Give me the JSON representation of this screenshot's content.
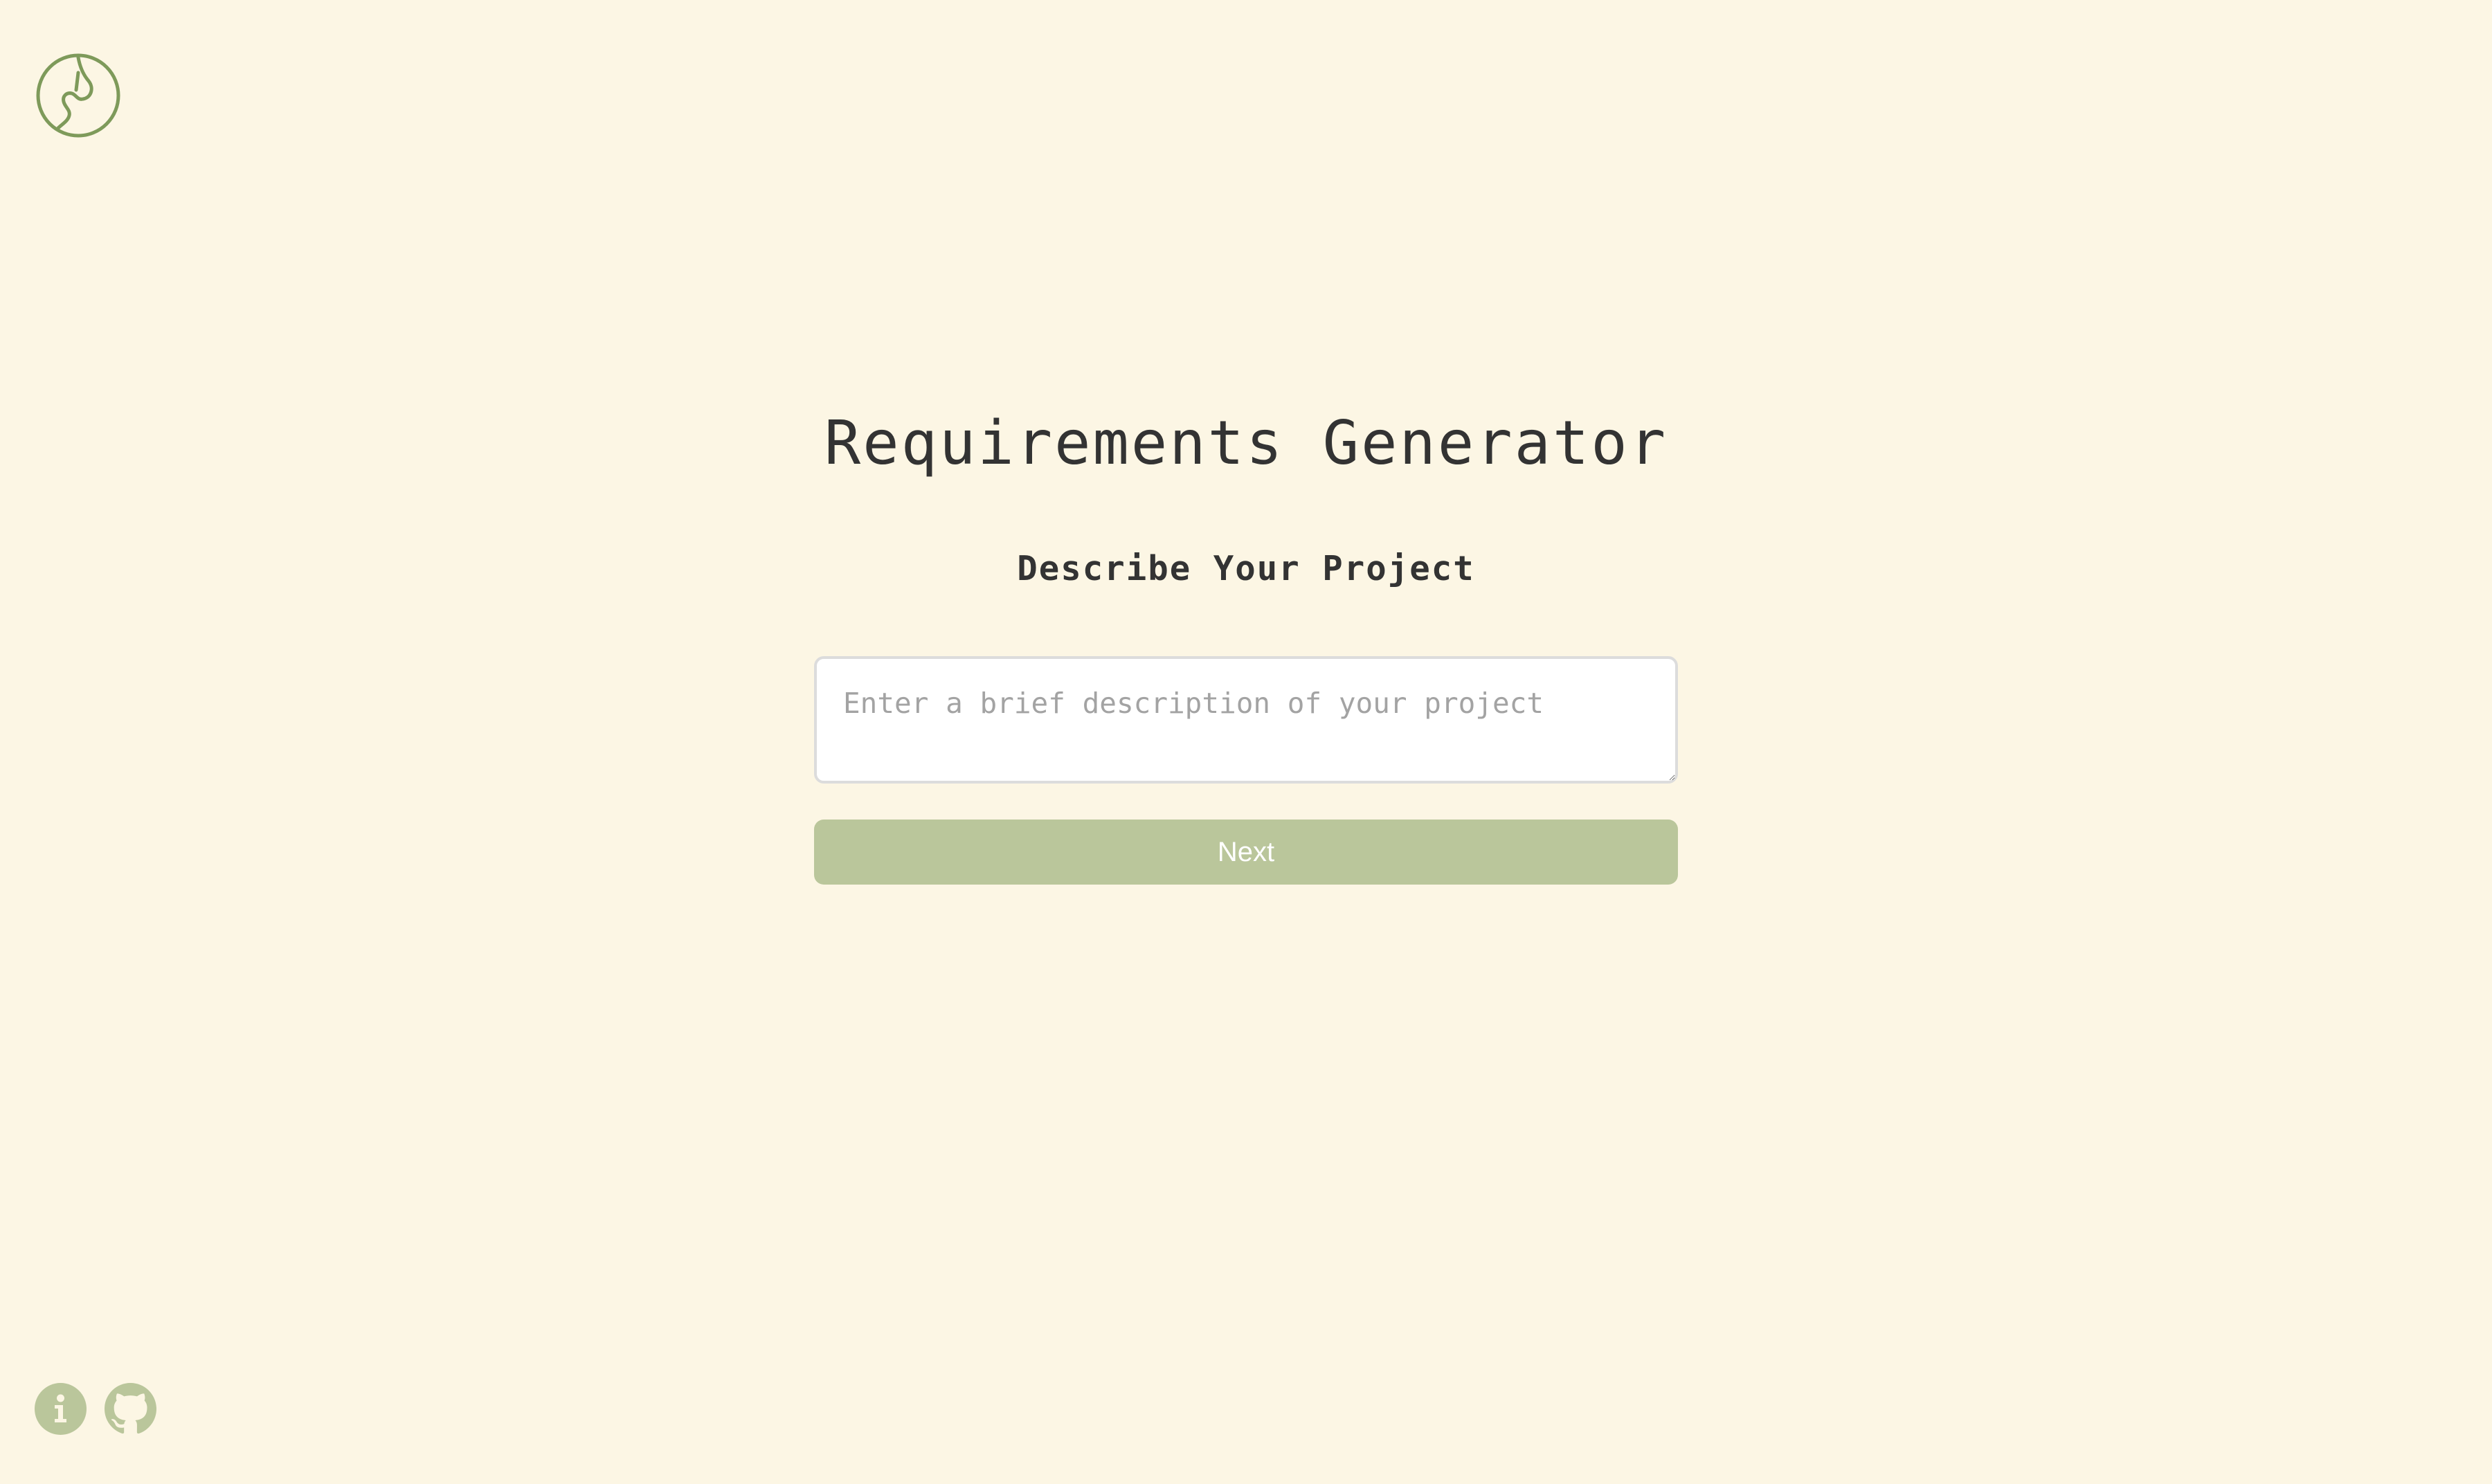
{
  "app": {
    "logo_icon": "leaf-swirl-logo-icon",
    "accent_color": "#7e9a5a",
    "muted_accent_color": "#bac69b",
    "background_color": "#fcf6e4"
  },
  "main": {
    "title": "Requirements Generator",
    "subtitle": "Describe Your Project",
    "description": {
      "value": "",
      "placeholder": "Enter a brief description of your project"
    },
    "next_label": "Next"
  },
  "footer": {
    "info_icon": "info-icon",
    "github_icon": "github-icon"
  }
}
